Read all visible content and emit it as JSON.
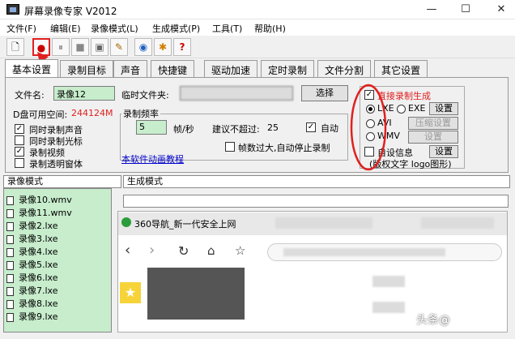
{
  "window": {
    "title": "屏幕录像专家 V2012",
    "min": "—",
    "max": "☐",
    "close": "✕"
  },
  "menu": [
    "文件(F)",
    "编辑(E)",
    "录像模式(L)",
    "生成模式(P)",
    "工具(T)",
    "帮助(H)"
  ],
  "toolbar": {
    "icons": [
      "new-file-icon",
      "record-icon",
      "pause-icon",
      "stop-icon",
      "camera-icon",
      "pen-icon",
      "globe-icon",
      "gift-icon",
      "help-icon"
    ],
    "glyphs": [
      "🗋",
      "●",
      "⏸",
      "■",
      "▣",
      "✎",
      "◉",
      "✱",
      "?"
    ]
  },
  "tabs": [
    "基本设置",
    "录制目标",
    "声音",
    "快捷键",
    "驱动加速",
    "定时录制",
    "文件分割",
    "其它设置"
  ],
  "settings": {
    "filename_label": "文件名:",
    "filename_value": "录像12",
    "tempfolder_label": "临时文件夹:",
    "select_button": "选择",
    "disk_free_label": "D盘可用空间:",
    "disk_free_value": "244124M",
    "sync_audio": "同时录制声音",
    "sync_cursor": "同时录制光标",
    "record_video": "录制视频",
    "record_transparent": "录制透明窗体",
    "framerate_group": "录制频率",
    "framerate_value": "5",
    "framerate_unit": "帧/秒",
    "suggest_label": "建议不超过:",
    "suggest_value": "25",
    "auto_label": "自动",
    "stop_on_overflow": "帧数过大,自动停止录制",
    "tutorial_link": "本软件动画教程"
  },
  "output": {
    "direct_generate": "直接录制生成",
    "lxe": "LXE",
    "exe": "EXE",
    "settings_btn": "设置",
    "avi": "AVI",
    "compress_btn": "压缩设置",
    "settings_btn2": "设置",
    "wmv": "WMV",
    "custom_info": "自设信息",
    "settings_btn3": "设置",
    "copyright": "(版权文字 logo图形)"
  },
  "lower_tabs": {
    "record_mode": "录像模式",
    "generate_mode": "生成模式"
  },
  "files": [
    "录像10.wmv",
    "录像11.wmv",
    "录像2.lxe",
    "录像3.lxe",
    "录像4.lxe",
    "录像5.lxe",
    "录像6.lxe",
    "录像7.lxe",
    "录像8.lxe",
    "录像9.lxe"
  ],
  "browser": {
    "tab_title": "360导航_新一代安全上网",
    "watermark": "头条@"
  },
  "colors": {
    "accent_red": "#e02020",
    "link_blue": "#0000cc",
    "list_green": "#c7edcc"
  }
}
